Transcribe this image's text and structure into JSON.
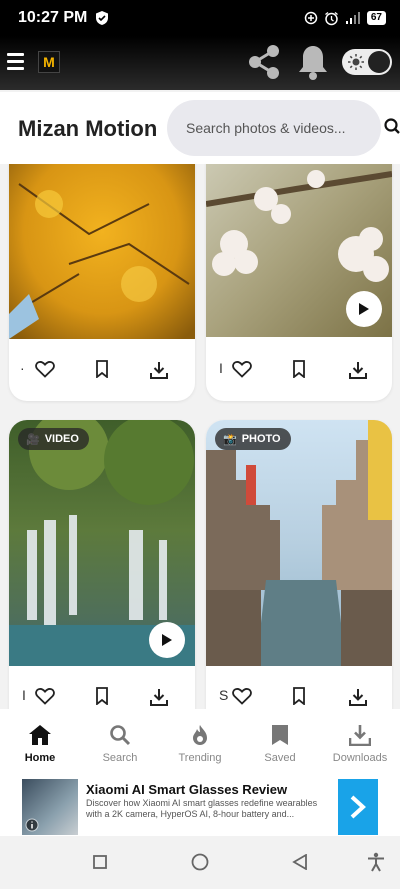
{
  "status": {
    "time": "10:27 PM",
    "battery": "67"
  },
  "app": {
    "title": "Mizan Motion",
    "logo_letter": "M"
  },
  "search": {
    "placeholder": "Search photos & videos..."
  },
  "cards": [
    {
      "badge": "",
      "action_dot": "·"
    },
    {
      "badge": "",
      "action_dot": "I"
    },
    {
      "badge": "VIDEO",
      "badge_icon": "🎥",
      "action_dot": "I"
    },
    {
      "badge": "PHOTO",
      "badge_icon": "📸",
      "action_dot": "S"
    }
  ],
  "nav": {
    "items": [
      {
        "label": "Home",
        "icon": "home-icon"
      },
      {
        "label": "Search",
        "icon": "search-icon"
      },
      {
        "label": "Trending",
        "icon": "fire-icon"
      },
      {
        "label": "Saved",
        "icon": "bookmark-icon"
      },
      {
        "label": "Downloads",
        "icon": "download-icon"
      }
    ]
  },
  "ad": {
    "title": "Xiaomi AI Smart Glasses Review",
    "desc": "Discover how Xiaomi AI smart glasses redefine wearables with a 2K camera, HyperOS AI, 8-hour battery and..."
  },
  "colors": {
    "accent": "#19a3e8",
    "bar": "#000000"
  }
}
